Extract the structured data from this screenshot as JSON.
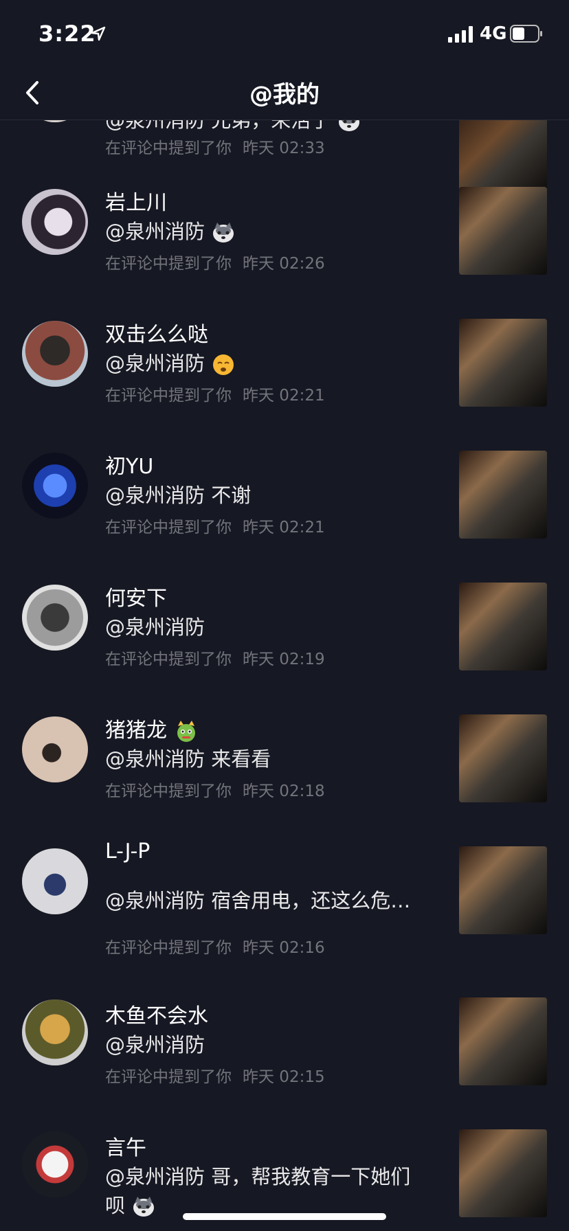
{
  "status": {
    "time": "3:22",
    "network": "4G"
  },
  "header": {
    "title": "@我的"
  },
  "items": [
    {
      "name": "",
      "comment": "@泉州消防 兄弟，来活了",
      "action": "在评论中提到了你",
      "time": "昨天 02:33",
      "emoji": "husky"
    },
    {
      "name": "岩上川",
      "comment": "@泉州消防",
      "action": "在评论中提到了你",
      "time": "昨天 02:26",
      "emoji": "husky"
    },
    {
      "name": "双击么么哒",
      "comment": "@泉州消防",
      "action": "在评论中提到了你",
      "time": "昨天 02:21",
      "emoji": "sleepy-face"
    },
    {
      "name": "初YU",
      "comment": "@泉州消防 不谢",
      "action": "在评论中提到了你",
      "time": "昨天 02:21"
    },
    {
      "name": "何安下",
      "comment": "@泉州消防",
      "action": "在评论中提到了你",
      "time": "昨天 02:19"
    },
    {
      "name": "猪猪龙",
      "comment": "@泉州消防 来看看",
      "action": "在评论中提到了你",
      "time": "昨天 02:18",
      "name_emoji": "dragon"
    },
    {
      "name": "L-J-P",
      "comment": "@泉州消防 宿舍用电，还这么危…",
      "action": "在评论中提到了你",
      "time": "昨天 02:16"
    },
    {
      "name": "木鱼不会水",
      "comment": "@泉州消防",
      "action": "在评论中提到了你",
      "time": "昨天 02:15"
    },
    {
      "name": "言午",
      "comment": "@泉州消防 哥，帮我教育一下她们",
      "comment2": "呗",
      "emoji": "husky"
    }
  ]
}
